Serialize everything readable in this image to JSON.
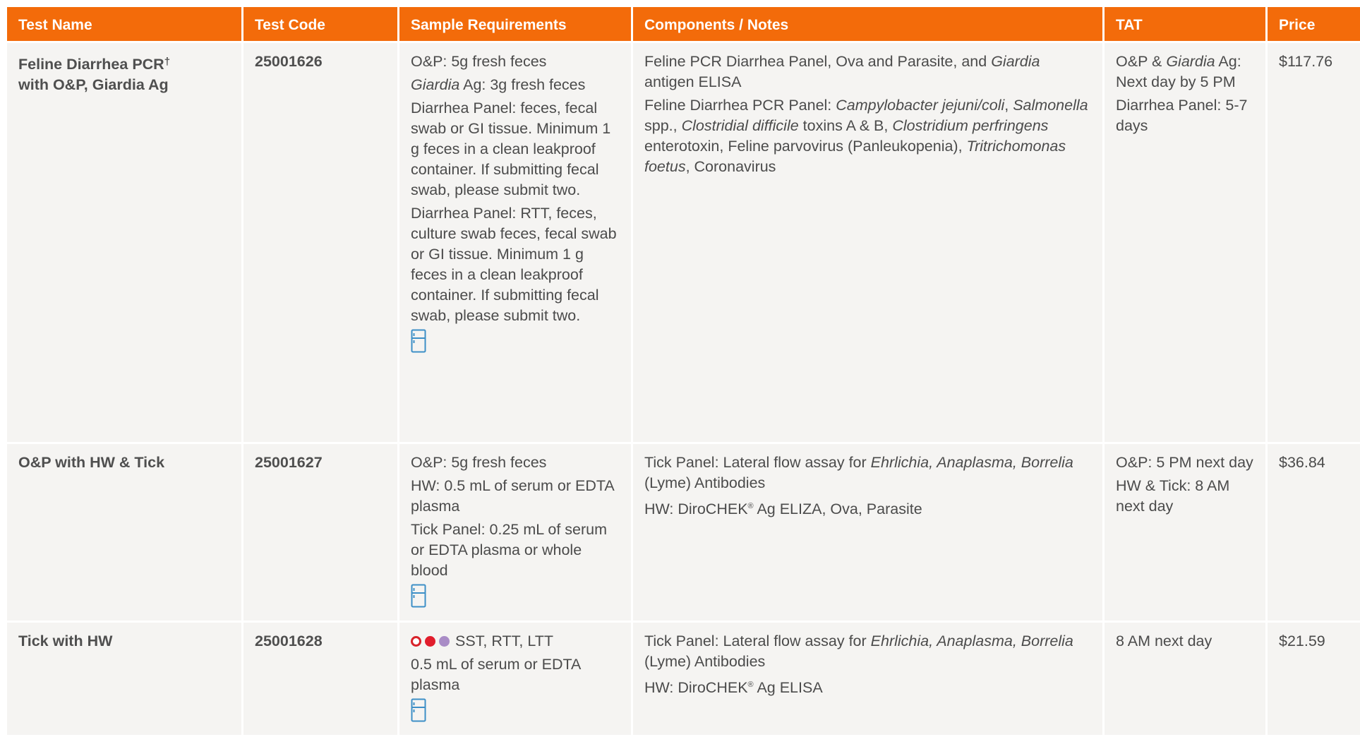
{
  "columns": [
    "Test Name",
    "Test Code",
    "Sample Requirements",
    "Components / Notes",
    "TAT",
    "Price"
  ],
  "colors": {
    "header_bg": "#f36b0a",
    "cell_bg": "#f5f4f2",
    "fridge_icon": "#3d8fc7",
    "sst_dot": "#d8232a",
    "rtt_dot": "#e11d2c",
    "ltt_dot": "#a98cc6"
  },
  "rows": [
    {
      "name": "Feline Diarrhea PCR",
      "name_sup": "†",
      "name_line2": "with O&P, Giardia Ag",
      "code": "25001626",
      "sample": {
        "p1": "O&P: 5g fresh feces",
        "p2_italic": "Giardia",
        "p2_rest": " Ag: 3g fresh feces",
        "p3": "Diarrhea Panel: feces, fecal swab or GI tissue. Minimum 1 g feces in a clean leakproof container. If submitting fecal swab, please submit two.",
        "p4": "Diarrhea Panel: RTT, feces, culture swab feces, fecal swab or GI tissue. Minimum 1 g feces in a clean leakproof container. If submitting fecal swab, please submit two.",
        "icon": "refrigerator-icon"
      },
      "notes": {
        "p1_a": "Feline PCR Diarrhea Panel, Ova and Parasite, and ",
        "p1_i": "Giardia",
        "p1_b": " antigen ELISA",
        "p2_a": "Feline Diarrhea PCR Panel: ",
        "p2_i1": "Campylobacter jejuni/coli",
        "p2_b": ", ",
        "p2_i2": "Salmonella",
        "p2_c": " spp., ",
        "p2_i3": "Clostridial difficile",
        "p2_d": " toxins A & B, ",
        "p2_i4": "Clostridium perfringens",
        "p2_e": " enterotoxin, Feline parvovirus (Panleukopenia), ",
        "p2_i5": "Tritrichomonas foetus",
        "p2_f": ", Coronavirus"
      },
      "tat": {
        "p1_a": "O&P & ",
        "p1_i": "Giardia",
        "p1_b": " Ag: Next day by 5 PM",
        "p2": "Diarrhea Panel: 5-7 days"
      },
      "price": "$117.76"
    },
    {
      "name": "O&P with HW & Tick",
      "code": "25001627",
      "sample": {
        "p1": "O&P: 5g fresh feces",
        "p2": "HW: 0.5 mL of serum or EDTA plasma",
        "p3": "Tick Panel: 0.25 mL of serum or EDTA plasma or whole blood",
        "icon": "refrigerator-icon"
      },
      "notes": {
        "p1_a": "Tick Panel: Lateral flow assay for ",
        "p1_i": "Ehrlichia, Anaplasma, Borrelia",
        "p1_b": " (Lyme) Antibodies",
        "p2_a": "HW: DiroCHEK",
        "p2_sup": "®",
        "p2_b": " Ag ELIZA, Ova, Parasite"
      },
      "tat": {
        "p1": "O&P: 5 PM next day",
        "p2": "HW & Tick: 8 AM next day"
      },
      "price": "$36.84"
    },
    {
      "name": "Tick with HW",
      "code": "25001628",
      "sample": {
        "tubes": "SST, RTT, LTT",
        "p2": "0.5 mL of serum or EDTA plasma",
        "icon": "refrigerator-icon"
      },
      "notes": {
        "p1_a": "Tick Panel: Lateral flow assay for ",
        "p1_i": "Ehrlichia, Anaplasma, Borrelia",
        "p1_b": " (Lyme) Antibodies",
        "p2_a": "HW: DiroCHEK",
        "p2_sup": "®",
        "p2_b": " Ag ELISA"
      },
      "tat": {
        "p1": "8 AM next day"
      },
      "price": "$21.59"
    }
  ]
}
